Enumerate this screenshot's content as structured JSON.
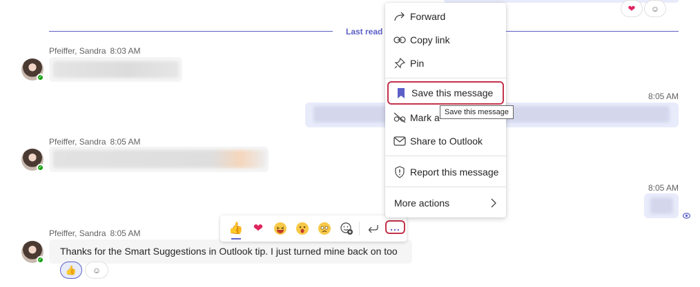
{
  "divider": {
    "label": "Last read"
  },
  "messages": [
    {
      "sender": "Pfeiffer, Sandra",
      "time": "8:03 AM"
    },
    {
      "time": "8:05 AM"
    },
    {
      "sender": "Pfeiffer, Sandra",
      "time": "8:05 AM"
    },
    {
      "time": "8:05 AM"
    },
    {
      "sender": "Pfeiffer, Sandra",
      "time": "8:05 AM",
      "text": "Thanks for the Smart Suggestions in Outlook tip.  I just turned mine back on too"
    }
  ],
  "top_reactions": [
    {
      "icon": "heart-emoji"
    },
    {
      "icon": "add-reaction-icon"
    }
  ],
  "bottom_reactions": [
    {
      "icon": "thumbs-up-emoji"
    },
    {
      "icon": "add-reaction-icon"
    }
  ],
  "menu": {
    "forward": "Forward",
    "copy_link": "Copy link",
    "pin": "Pin",
    "save": "Save this message",
    "mark_unread": "Mark a",
    "share_outlook": "Share to Outlook",
    "report": "Report this message",
    "more_actions": "More actions"
  },
  "tooltip": "Save this message",
  "toolbar": {
    "reactions": [
      "thumbs-up",
      "heart",
      "laughing",
      "surprised",
      "sad"
    ],
    "more_label": "..."
  },
  "colors": {
    "accent": "#5b5fc7",
    "highlight": "#c4314b",
    "presence": "#13a10e"
  }
}
